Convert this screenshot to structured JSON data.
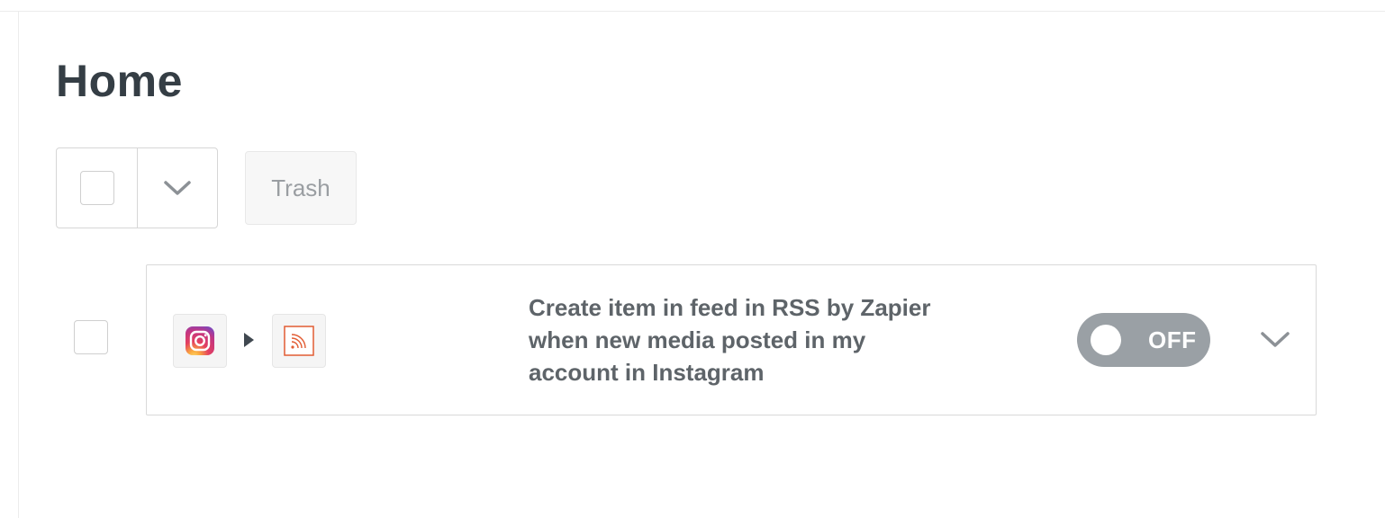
{
  "page": {
    "title": "Home"
  },
  "toolbar": {
    "select_all_icon": "checkbox-empty",
    "dropdown_icon": "chevron-down-icon",
    "trash_label": "Trash"
  },
  "zaps": [
    {
      "trigger_app_icon": "instagram-icon",
      "action_app_icon": "rss-icon",
      "description": "Create item in feed in RSS by Zapier when new media posted in my account in Instagram",
      "status_label": "OFF",
      "enabled": false
    }
  ],
  "colors": {
    "title_text": "#353e45",
    "description_text": "#5e6469",
    "toggle_off_bg": "#9aa0a5",
    "rss_orange": "#e25c33"
  }
}
